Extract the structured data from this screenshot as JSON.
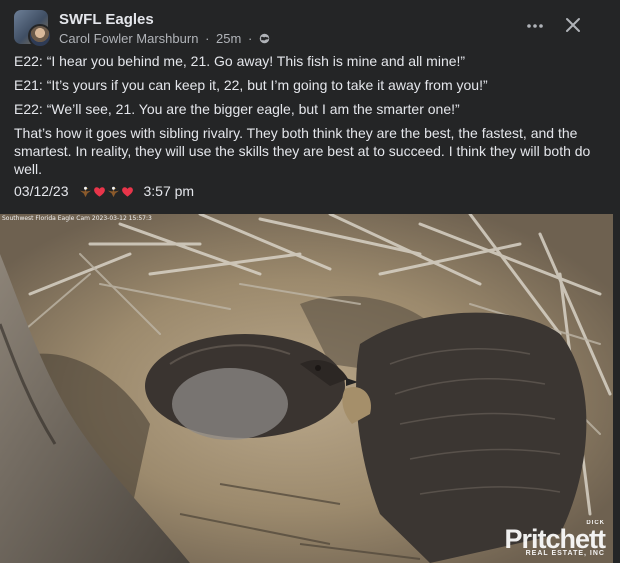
{
  "header": {
    "group_name": "SWFL Eagles",
    "author": "Carol Fowler Marshburn",
    "time_ago": "25m",
    "separator": "·"
  },
  "post": {
    "paragraphs": [
      "E22: “I hear you behind me, 21. Go away! This fish is mine and all mine!”",
      "E21: “It’s yours if you can keep it, 22, but I’m going to take it away from you!”",
      "E22: “We’ll see, 21. You are the bigger eagle, but I am the smarter one!”",
      "That’s how it goes with sibling rivalry. They both think they are the best, the fastest, and the smartest. In reality, they will use the skills they are best at to succeed. I think they will both do well."
    ],
    "date": "03/12/23",
    "time": "3:57 pm",
    "emojis": [
      "eagle-icon",
      "heart-icon",
      "eagle-icon",
      "heart-icon"
    ]
  },
  "photo": {
    "cam_caption": "Southwest Florida Eagle Cam 2023-03-12 15:57:3",
    "watermark_top": "DICK",
    "watermark_main": "Pritchett",
    "watermark_sub": "REAL ESTATE, INC"
  },
  "colors": {
    "background": "#242526",
    "text_primary": "#e4e6eb",
    "text_secondary": "#b0b3b8"
  }
}
